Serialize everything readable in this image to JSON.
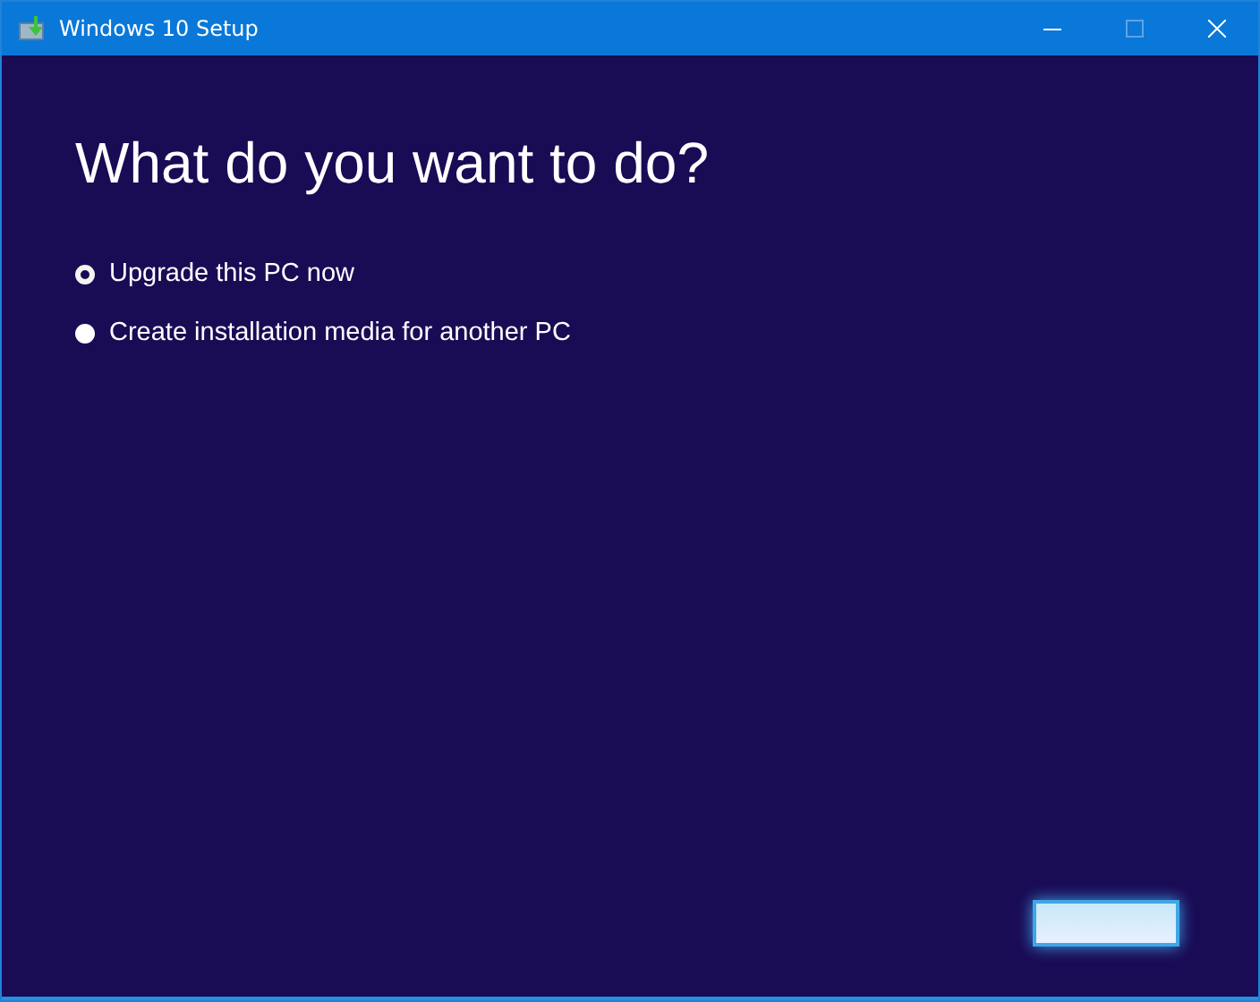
{
  "window": {
    "title": "Windows 10 Setup",
    "maximize_disabled": true
  },
  "heading": "What do you want to do?",
  "options": [
    {
      "label": "Upgrade this PC now",
      "selected": true
    },
    {
      "label": "Create installation media for another PC",
      "selected": false
    }
  ]
}
